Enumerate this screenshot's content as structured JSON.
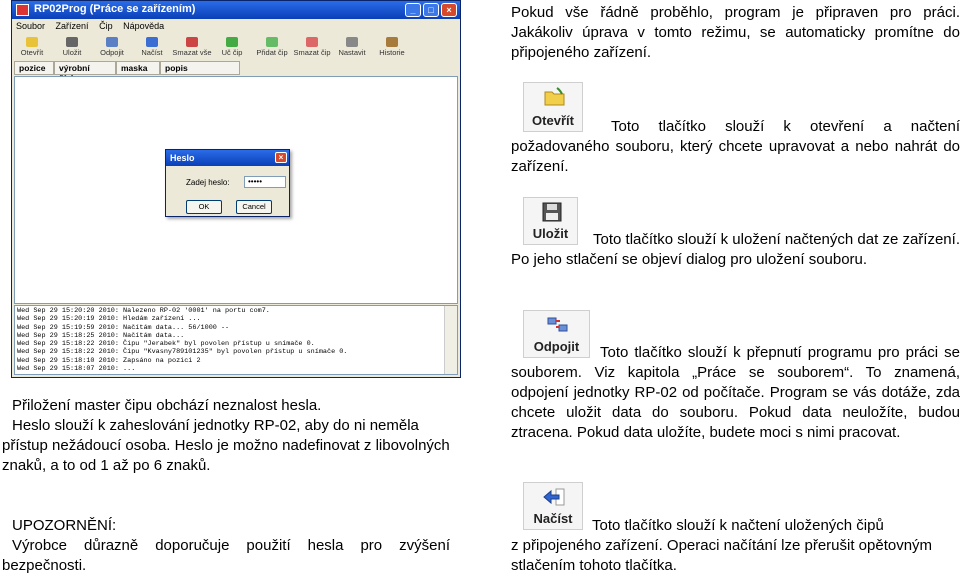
{
  "app": {
    "title": "RP02Prog (Práce se zařízením)",
    "menu": [
      "Soubor",
      "Zařízení",
      "Čip",
      "Nápověda"
    ],
    "toolbar": [
      "Otevřít",
      "Uložit",
      "Odpojit",
      "Načíst",
      "Smazat vše",
      "Uč čip",
      "Přidat čip",
      "Smazat čip",
      "Nastavit",
      "Historie"
    ],
    "columns": [
      "pozice",
      "výrobní číslo",
      "maska",
      "popis"
    ],
    "log": [
      "Wed Sep 29 15:20:20 2010: Nalezeno RP-02 '0001' na portu com7.",
      "Wed Sep 29 15:20:19 2010: Hledám zařízení ...",
      "Wed Sep 29 15:19:59 2010: Načítám data... 56/1000 --",
      "Wed Sep 29 15:18:25 2010: Načítám data...",
      "Wed Sep 29 15:18:22 2010: Čipu \"Jerabek\" byl povolen přístup u snímače 0.",
      "Wed Sep 29 15:18:22 2010: Čipu \"Kvasny789101235\" byl povolen přístup u snímače 0.",
      "Wed Sep 29 15:18:10 2010: Zapsáno na pozici 2",
      "Wed Sep 29 15:18:07 2010: ..."
    ]
  },
  "dialog": {
    "title": "Heslo",
    "label": "Zadej heslo:",
    "value": "•••••",
    "ok": "OK",
    "cancel": "Cancel"
  },
  "buttons": {
    "open": "Otevřít",
    "save": "Uložit",
    "disconnect": "Odpojit",
    "load": "Načíst"
  },
  "text": {
    "intro": "Pokud vše řádně proběhlo, program je připraven pro práci. Jakákoliv úprava v tomto režimu, se automaticky promítne do připojeného zařízení.",
    "open_desc": "Toto tlačítko slouží k otevření a načtení požadovaného souboru, který chcete upravovat a nebo nahrát do zařízení.",
    "save_desc": "Toto tlačítko slouží k uložení načtených dat ze zařízení. Po jeho stlačení se objeví dialog pro uložení souboru.",
    "disconnect_desc": "Toto tlačítko slouží k přepnutí programu pro práci se souborem. Viz kapitola „Práce se souborem“. To znamená, odpojení jednotky RP-02 od počítače. Program se vás dotáže, zda chcete uložit data do souboru. Pokud data neuložíte, budou ztracena. Pokud data uložíte, budete moci s nimi pracovat.",
    "load_desc_1": "Toto tlačítko slouží k načtení uložených čipů",
    "load_desc_2": "z připojeného zařízení. Operaci načítání lze přerušit opětovným stlačením tohoto tlačítka.",
    "password_p1": "Přiložení master čipu obchází neznalost hesla.",
    "password_p2": "Heslo slouží k zaheslování jednotky RP-02, aby do ni neměla přístup nežádoucí osoba. Heslo je možno nadefinovat z libovolných znaků, a to od 1 až po 6 znaků.",
    "warning_title": "UPOZORNĚNÍ:",
    "warning_text": "Výrobce důrazně doporučuje použití hesla pro zvýšení bezpečnosti."
  },
  "colors": {
    "titlebar": "#0a3fb7",
    "window_bg": "#ece9d8"
  }
}
